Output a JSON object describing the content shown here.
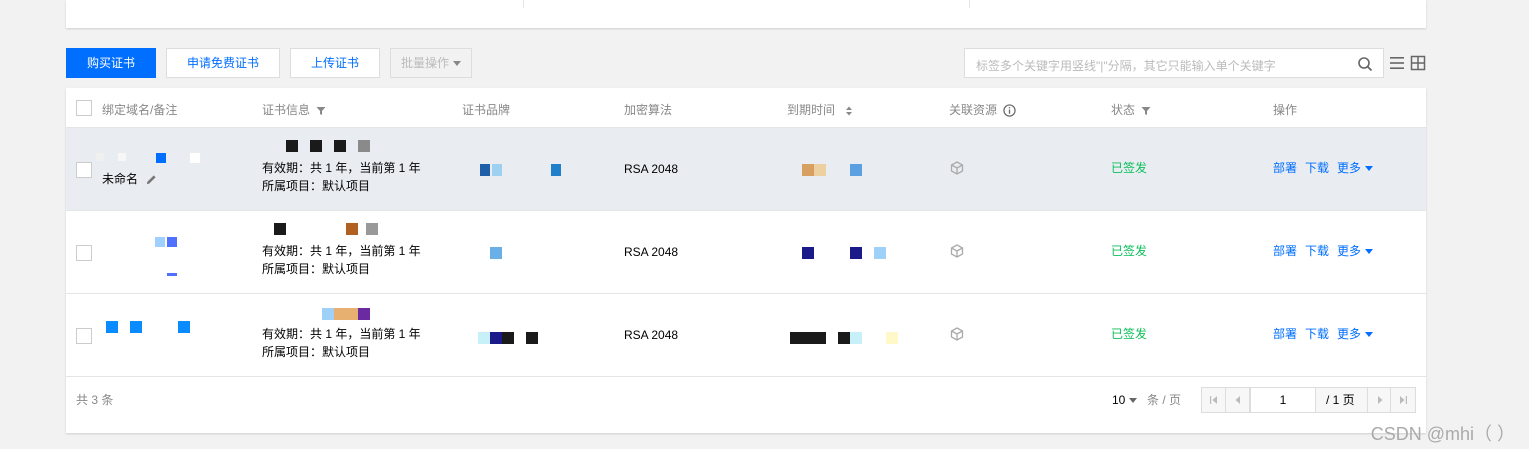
{
  "toolbar": {
    "buy_label": "购买证书",
    "apply_free_label": "申请免费证书",
    "upload_label": "上传证书",
    "batch_label": "批量操作",
    "search_placeholder": "标签多个关键字用竖线\"|\"分隔，其它只能输入单个关键字"
  },
  "table": {
    "headers": {
      "domain": "绑定域名/备注",
      "cert_info": "证书信息",
      "brand": "证书品牌",
      "algorithm": "加密算法",
      "expire": "到期时间",
      "resources": "关联资源",
      "status": "状态",
      "actions": "操作"
    },
    "rows": [
      {
        "remark": "未命名",
        "validity": "有效期：共 1 年，当前第 1 年",
        "project": "所属项目：默认项目",
        "algorithm": "RSA 2048",
        "status": "已签发",
        "deploy": "部署",
        "download": "下载",
        "more": "更多"
      },
      {
        "validity": "有效期：共 1 年，当前第 1 年",
        "project": "所属项目：默认项目",
        "algorithm": "RSA 2048",
        "status": "已签发",
        "deploy": "部署",
        "download": "下载",
        "more": "更多"
      },
      {
        "validity": "有效期：共 1 年，当前第 1 年",
        "project": "所属项目：默认项目",
        "algorithm": "RSA 2048",
        "status": "已签发",
        "deploy": "部署",
        "download": "下载",
        "more": "更多"
      }
    ]
  },
  "footer": {
    "total": "共 3 条",
    "page_size": "10",
    "per_page": "条 / 页",
    "page": "1",
    "page_total": "/ 1 页"
  },
  "watermark": "CSDN @mhi（ ）",
  "colors": {
    "primary": "#006eff",
    "status_ok": "#0abf5b",
    "highlight_row": "#e9edf2"
  }
}
